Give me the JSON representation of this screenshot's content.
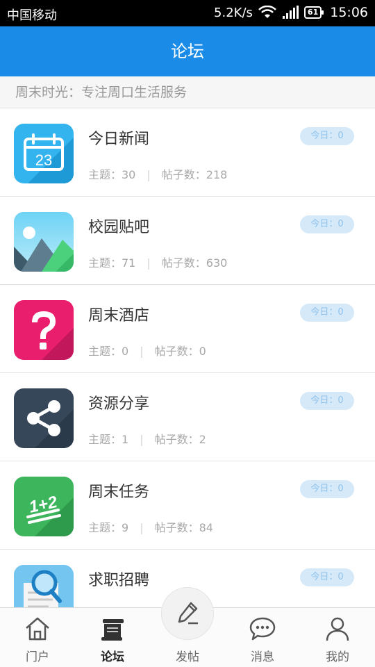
{
  "status_bar": {
    "carrier": "中国移动",
    "speed": "5.2K/s",
    "battery": "61",
    "time": "15:06"
  },
  "header": {
    "title": "论坛"
  },
  "subtitle": "周末时光：专注周口生活服务",
  "forums": [
    {
      "name": "今日新闻",
      "topics": "主题：30",
      "posts": "帖子数：218",
      "today": "今日：0",
      "icon": "calendar-icon",
      "icon_text": "23"
    },
    {
      "name": "校园贴吧",
      "topics": "主题：71",
      "posts": "帖子数：630",
      "today": "今日：0",
      "icon": "landscape-icon"
    },
    {
      "name": "周末酒店",
      "topics": "主题：0",
      "posts": "帖子数：0",
      "today": "今日：0",
      "icon": "question-icon"
    },
    {
      "name": "资源分享",
      "topics": "主题：1",
      "posts": "帖子数：2",
      "today": "今日：0",
      "icon": "share-icon"
    },
    {
      "name": "周末任务",
      "topics": "主题：9",
      "posts": "帖子数：84",
      "today": "今日：0",
      "icon": "math-icon",
      "icon_text": "1+2"
    },
    {
      "name": "求职招聘",
      "topics": "",
      "posts": "",
      "today": "今日：0",
      "icon": "document-search-icon"
    }
  ],
  "bottom_nav": [
    {
      "label": "门户",
      "icon": "home-icon",
      "active": false
    },
    {
      "label": "论坛",
      "icon": "forum-icon",
      "active": true
    },
    {
      "label": "发帖",
      "icon": "pencil-icon",
      "active": false
    },
    {
      "label": "消息",
      "icon": "chat-bubble-icon",
      "active": false
    },
    {
      "label": "我的",
      "icon": "user-icon",
      "active": false
    }
  ],
  "colors": {
    "primary": "#1a8ce8",
    "badge_bg": "#d5e9f9",
    "badge_text": "#8fc2ec"
  }
}
